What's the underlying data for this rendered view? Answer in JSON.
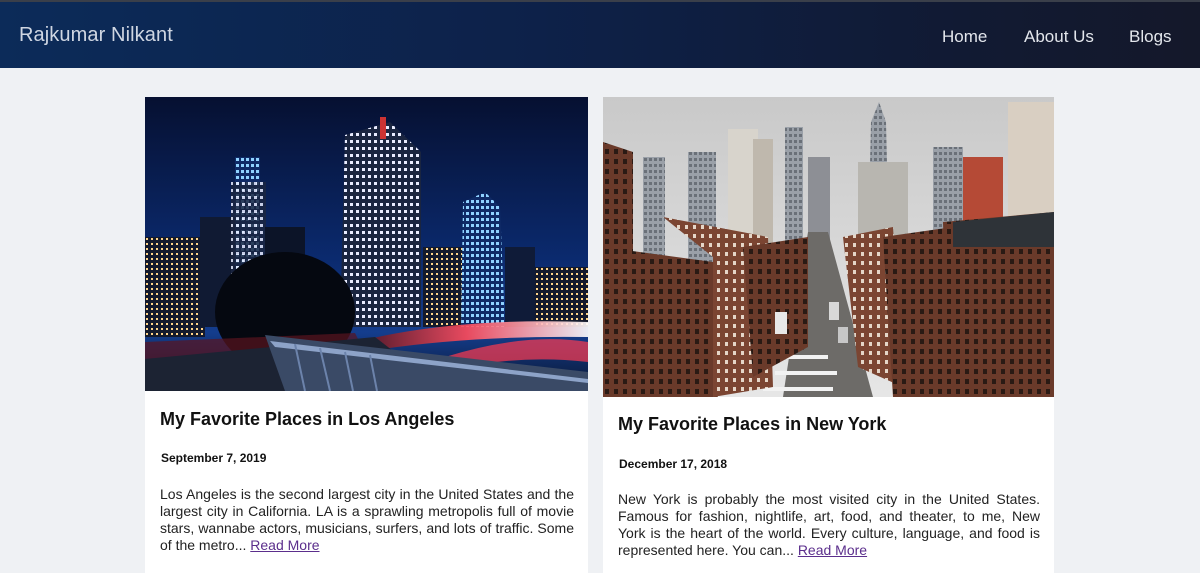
{
  "header": {
    "brand": "Rajkumar Nilkant",
    "nav": [
      {
        "label": "Home"
      },
      {
        "label": "About Us"
      },
      {
        "label": "Blogs"
      }
    ]
  },
  "posts": [
    {
      "title": "My Favorite Places in Los Angeles",
      "date": "September 7, 2019",
      "excerpt": "Los Angeles is the second largest city in the United States and the largest city in California. LA is a sprawling metropolis full of movie stars, wannabe actors, musicians, surfers, and lots of traffic. Some of the metro...",
      "read_more": "Read More",
      "image_desc": "los-angeles-night-skyline-photo"
    },
    {
      "title": "My Favorite Places in New York",
      "date": "December 17, 2018",
      "excerpt": "New York is probably the most visited city in the United States. Famous for fashion, nightlife, art, food, and theater, to me, New York is the heart of the world. Every culture, language, and food is represented here. You can...",
      "read_more": "Read More",
      "image_desc": "new-york-street-skyline-photo"
    }
  ],
  "colors": {
    "header_start": "#0c2b59",
    "header_end": "#14182a",
    "page_bg": "#eff1f4",
    "link": "#5b2e8c"
  }
}
